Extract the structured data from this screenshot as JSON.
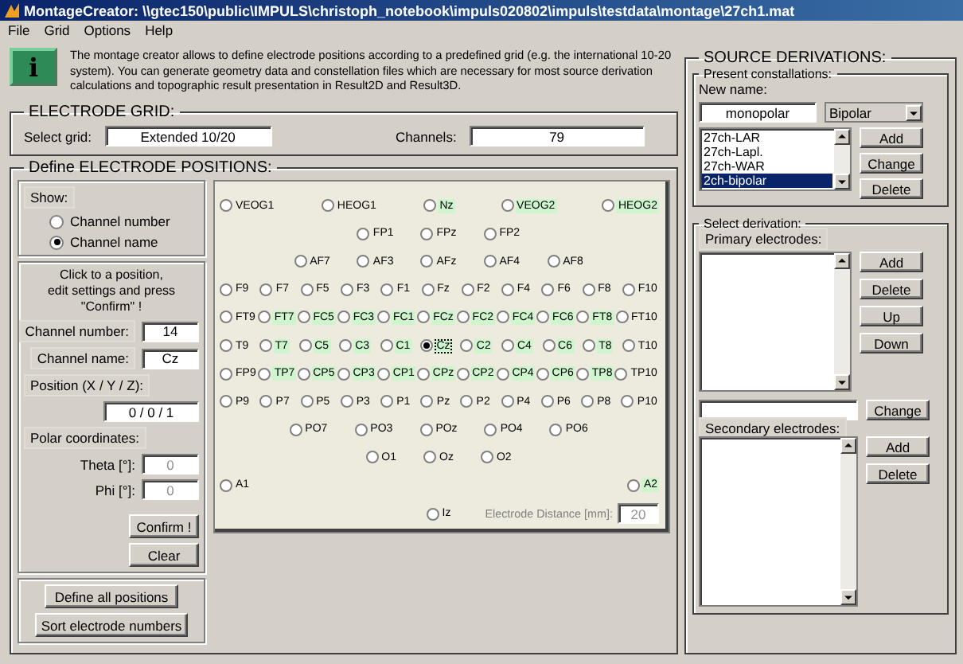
{
  "window": {
    "title": "MontageCreator: \\\\gtec150\\public\\IMPULS\\christoph_notebook\\impuls020802\\impuls\\testdata\\montage\\27ch1.mat"
  },
  "menu": [
    "File",
    "Grid",
    "Options",
    "Help"
  ],
  "info": {
    "glyph": "i",
    "text": "The montage creator allows to define electrode positions according to a predefined grid (e.g. the international 10-20 system). You can generate geometry data and constellation files which are necessary for most source derivation calculations and topographic result presentation in Result2D and Result3D."
  },
  "electrode_grid": {
    "title": "ELECTRODE GRID:",
    "select_label": "Select grid:",
    "select_value": "Extended 10/20",
    "channels_label": "Channels:",
    "channels_value": "79"
  },
  "positions": {
    "title": "Define ELECTRODE POSITIONS:",
    "show": {
      "label": "Show:",
      "options": [
        {
          "label": "Channel number",
          "selected": false
        },
        {
          "label": "Channel name",
          "selected": true
        }
      ]
    },
    "instructions": "Click to a position,\nedit settings and press \"Confirm\" !",
    "channel_number": {
      "label": "Channel number:",
      "value": "14"
    },
    "channel_name": {
      "label": "Channel name:",
      "value": "Cz"
    },
    "position": {
      "label": "Position (X / Y / Z):",
      "value": "0 / 0 / 1"
    },
    "polar": {
      "label": "Polar coordinates:",
      "fields": [
        {
          "label": "Theta [°]:",
          "value": "0",
          "disabled": true
        },
        {
          "label": "Phi [°]:",
          "value": "0",
          "disabled": true
        }
      ]
    },
    "buttons": [
      "Confirm !",
      "Clear"
    ],
    "bottom_buttons": [
      "Define all positions",
      "Sort electrode numbers"
    ],
    "electrode_rows": [
      {
        "kind": "spread",
        "items": [
          {
            "label": "VEOG1",
            "defined": false,
            "selected": false
          },
          {
            "label": "HEOG1",
            "defined": false,
            "selected": false
          },
          {
            "label": "Nz",
            "defined": true,
            "selected": false
          },
          {
            "label": "VEOG2",
            "defined": true,
            "selected": false
          },
          {
            "label": "HEOG2",
            "defined": true,
            "selected": false
          }
        ]
      },
      {
        "kind": "center",
        "items": [
          {
            "label": "FP1",
            "defined": false,
            "selected": false
          },
          {
            "label": "FPz",
            "defined": false,
            "selected": false
          },
          {
            "label": "FP2",
            "defined": false,
            "selected": false
          }
        ]
      },
      {
        "kind": "center",
        "items": [
          {
            "label": "AF7",
            "defined": false,
            "selected": false
          },
          {
            "label": "AF3",
            "defined": false,
            "selected": false
          },
          {
            "label": "AFz",
            "defined": false,
            "selected": false
          },
          {
            "label": "AF4",
            "defined": false,
            "selected": false
          },
          {
            "label": "AF8",
            "defined": false,
            "selected": false
          }
        ]
      },
      {
        "kind": "spread",
        "items": [
          {
            "label": "F9",
            "defined": false,
            "selected": false
          },
          {
            "label": "F7",
            "defined": false,
            "selected": false
          },
          {
            "label": "F5",
            "defined": false,
            "selected": false
          },
          {
            "label": "F3",
            "defined": false,
            "selected": false
          },
          {
            "label": "F1",
            "defined": false,
            "selected": false
          },
          {
            "label": "Fz",
            "defined": false,
            "selected": false
          },
          {
            "label": "F2",
            "defined": false,
            "selected": false
          },
          {
            "label": "F4",
            "defined": false,
            "selected": false
          },
          {
            "label": "F6",
            "defined": false,
            "selected": false
          },
          {
            "label": "F8",
            "defined": false,
            "selected": false
          },
          {
            "label": "F10",
            "defined": false,
            "selected": false
          }
        ]
      },
      {
        "kind": "spread",
        "items": [
          {
            "label": "FT9",
            "defined": false,
            "selected": false
          },
          {
            "label": "FT7",
            "defined": true,
            "selected": false
          },
          {
            "label": "FC5",
            "defined": true,
            "selected": false
          },
          {
            "label": "FC3",
            "defined": true,
            "selected": false
          },
          {
            "label": "FC1",
            "defined": true,
            "selected": false
          },
          {
            "label": "FCz",
            "defined": true,
            "selected": false
          },
          {
            "label": "FC2",
            "defined": true,
            "selected": false
          },
          {
            "label": "FC4",
            "defined": true,
            "selected": false
          },
          {
            "label": "FC6",
            "defined": true,
            "selected": false
          },
          {
            "label": "FT8",
            "defined": true,
            "selected": false
          },
          {
            "label": "FT10",
            "defined": false,
            "selected": false
          }
        ]
      },
      {
        "kind": "spread",
        "items": [
          {
            "label": "T9",
            "defined": false,
            "selected": false
          },
          {
            "label": "T7",
            "defined": true,
            "selected": false
          },
          {
            "label": "C5",
            "defined": true,
            "selected": false
          },
          {
            "label": "C3",
            "defined": true,
            "selected": false
          },
          {
            "label": "C1",
            "defined": true,
            "selected": false
          },
          {
            "label": "Cz",
            "defined": true,
            "selected": true
          },
          {
            "label": "C2",
            "defined": true,
            "selected": false
          },
          {
            "label": "C4",
            "defined": true,
            "selected": false
          },
          {
            "label": "C6",
            "defined": true,
            "selected": false
          },
          {
            "label": "T8",
            "defined": true,
            "selected": false
          },
          {
            "label": "T10",
            "defined": false,
            "selected": false
          }
        ]
      },
      {
        "kind": "spread",
        "items": [
          {
            "label": "FP9",
            "defined": false,
            "selected": false
          },
          {
            "label": "TP7",
            "defined": true,
            "selected": false
          },
          {
            "label": "CP5",
            "defined": true,
            "selected": false
          },
          {
            "label": "CP3",
            "defined": true,
            "selected": false
          },
          {
            "label": "CP1",
            "defined": true,
            "selected": false
          },
          {
            "label": "CPz",
            "defined": true,
            "selected": false
          },
          {
            "label": "CP2",
            "defined": true,
            "selected": false
          },
          {
            "label": "CP4",
            "defined": true,
            "selected": false
          },
          {
            "label": "CP6",
            "defined": true,
            "selected": false
          },
          {
            "label": "TP8",
            "defined": true,
            "selected": false
          },
          {
            "label": "TP10",
            "defined": false,
            "selected": false
          }
        ]
      },
      {
        "kind": "spread",
        "items": [
          {
            "label": "P9",
            "defined": false,
            "selected": false
          },
          {
            "label": "P7",
            "defined": false,
            "selected": false
          },
          {
            "label": "P5",
            "defined": false,
            "selected": false
          },
          {
            "label": "P3",
            "defined": false,
            "selected": false
          },
          {
            "label": "P1",
            "defined": false,
            "selected": false
          },
          {
            "label": "Pz",
            "defined": false,
            "selected": false
          },
          {
            "label": "P2",
            "defined": false,
            "selected": false
          },
          {
            "label": "P4",
            "defined": false,
            "selected": false
          },
          {
            "label": "P6",
            "defined": false,
            "selected": false
          },
          {
            "label": "P8",
            "defined": false,
            "selected": false
          },
          {
            "label": "P10",
            "defined": false,
            "selected": false
          }
        ]
      },
      {
        "kind": "center",
        "items": [
          {
            "label": "PO7",
            "defined": false,
            "selected": false
          },
          {
            "label": "PO3",
            "defined": false,
            "selected": false
          },
          {
            "label": "POz",
            "defined": false,
            "selected": false
          },
          {
            "label": "PO4",
            "defined": false,
            "selected": false
          },
          {
            "label": "PO6",
            "defined": false,
            "selected": false
          }
        ]
      },
      {
        "kind": "center",
        "items": [
          {
            "label": "O1",
            "defined": false,
            "selected": false
          },
          {
            "label": "Oz",
            "defined": false,
            "selected": false
          },
          {
            "label": "O2",
            "defined": false,
            "selected": false
          }
        ]
      },
      {
        "kind": "spread",
        "items": [
          {
            "label": "A1",
            "defined": false,
            "selected": false
          },
          {
            "label": "A2",
            "defined": true,
            "selected": false
          }
        ]
      },
      {
        "kind": "center",
        "items": [
          {
            "label": "Iz",
            "defined": false,
            "selected": false
          }
        ]
      }
    ],
    "distance": {
      "label": "Electrode Distance [mm]:",
      "value": "20",
      "disabled": true
    }
  },
  "source": {
    "title": "SOURCE DERIVATIONS:",
    "present": {
      "title": "Present constallations:",
      "new_name_label": "New name:",
      "new_name_value": "monopolar",
      "dropdown": "Bipolar",
      "list": [
        {
          "label": "27ch-LAR",
          "selected": false
        },
        {
          "label": "27ch-Lapl.",
          "selected": false
        },
        {
          "label": "27ch-WAR",
          "selected": false
        },
        {
          "label": "2ch-bipolar",
          "selected": true
        }
      ],
      "buttons": [
        "Add",
        "Change",
        "Delete"
      ]
    },
    "derivation": {
      "title": "Select derivation:",
      "primary_label": "Primary electrodes:",
      "primary_buttons": [
        "Add",
        "Delete",
        "Up",
        "Down"
      ],
      "change_button": "Change",
      "secondary_label": "Secondary electrodes:",
      "secondary_buttons": [
        "Add",
        "Delete"
      ]
    }
  }
}
